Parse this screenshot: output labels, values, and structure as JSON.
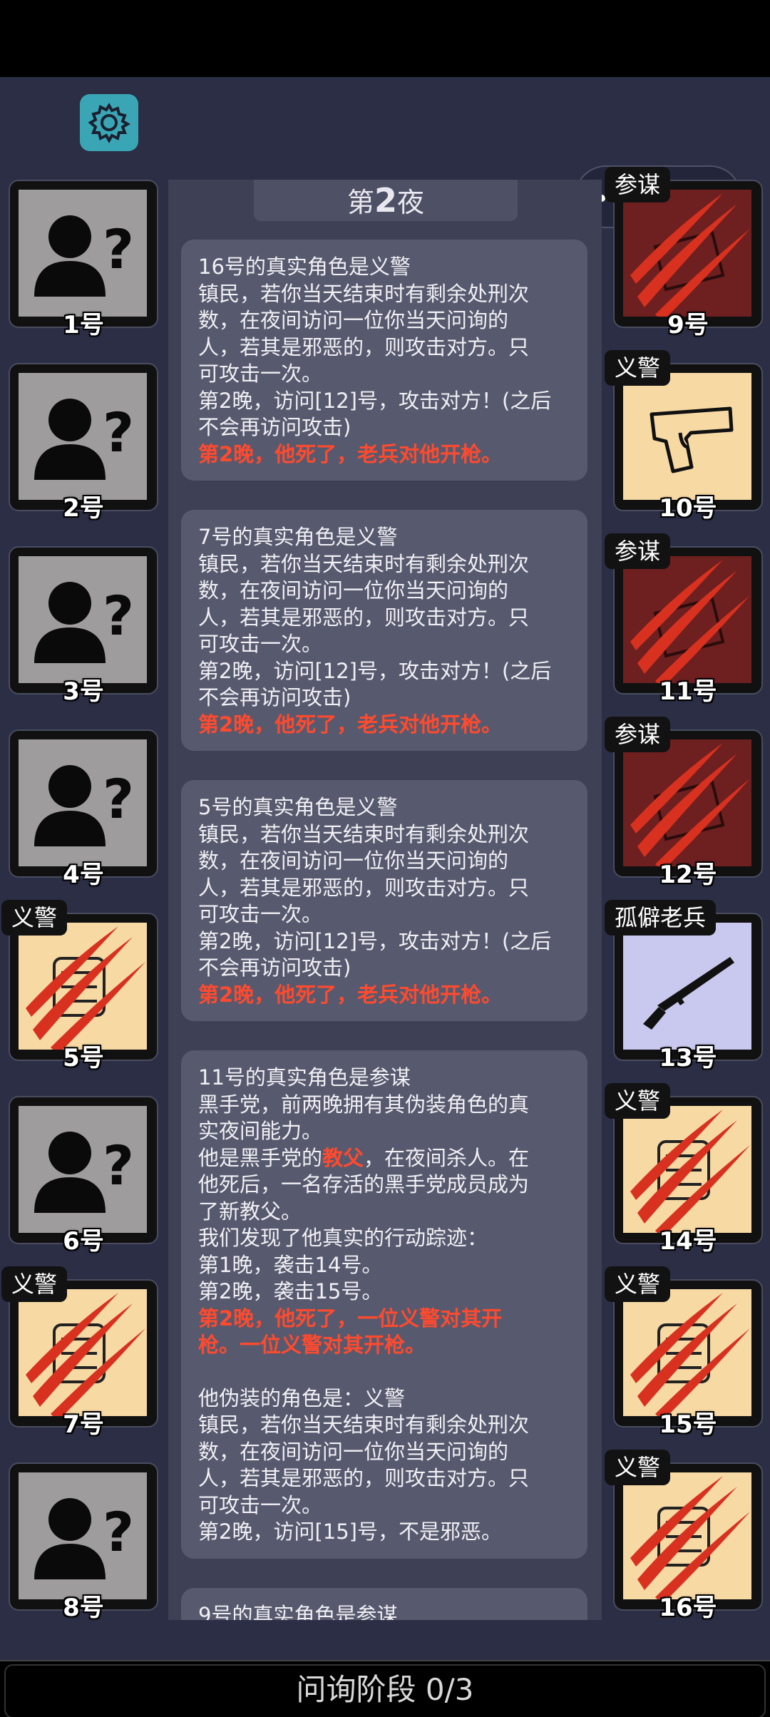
{
  "night_title_prefix": "第",
  "night_number": "2",
  "night_title_suffix": "夜",
  "left_seats": [
    {
      "num": "1号",
      "tag": "",
      "state": "unknown"
    },
    {
      "num": "2号",
      "tag": "",
      "state": "unknown"
    },
    {
      "num": "3号",
      "tag": "",
      "state": "unknown"
    },
    {
      "num": "4号",
      "tag": "",
      "state": "unknown"
    },
    {
      "num": "5号",
      "tag": "义警",
      "state": "dead-vigilante"
    },
    {
      "num": "6号",
      "tag": "",
      "state": "unknown"
    },
    {
      "num": "7号",
      "tag": "义警",
      "state": "dead-vigilante"
    },
    {
      "num": "8号",
      "tag": "",
      "state": "unknown"
    }
  ],
  "right_seats": [
    {
      "num": "9号",
      "tag": "参谋",
      "state": "dead-mafia"
    },
    {
      "num": "10号",
      "tag": "义警",
      "state": "vigilante-gun"
    },
    {
      "num": "11号",
      "tag": "参谋",
      "state": "dead-mafia"
    },
    {
      "num": "12号",
      "tag": "参谋",
      "state": "dead-mafia"
    },
    {
      "num": "13号",
      "tag": "孤僻老兵",
      "state": "veteran-rifle"
    },
    {
      "num": "14号",
      "tag": "义警",
      "state": "dead-vigilante"
    },
    {
      "num": "15号",
      "tag": "义警",
      "state": "dead-vigilante"
    },
    {
      "num": "16号",
      "tag": "义警",
      "state": "dead-vigilante"
    }
  ],
  "cards": [
    {
      "lines": [
        "16号的真实角色是义警",
        "镇民，若你当天结束时有剩余处刑次",
        "数，在夜间访问一位你当天问询的",
        "人，若其是邪恶的，则攻击对方。只",
        "可攻击一次。",
        "第2晚，访问[12]号，攻击对方！(之后",
        "不会再访问攻击)"
      ],
      "red": "第2晚，他死了，老兵对他开枪。"
    },
    {
      "lines": [
        "7号的真实角色是义警",
        "镇民，若你当天结束时有剩余处刑次",
        "数，在夜间访问一位你当天问询的",
        "人，若其是邪恶的，则攻击对方。只",
        "可攻击一次。",
        "第2晚，访问[12]号，攻击对方！(之后",
        "不会再访问攻击)"
      ],
      "red": "第2晚，他死了，老兵对他开枪。"
    },
    {
      "lines": [
        "5号的真实角色是义警",
        "镇民，若你当天结束时有剩余处刑次",
        "数，在夜间访问一位你当天问询的",
        "人，若其是邪恶的，则攻击对方。只",
        "可攻击一次。",
        "第2晚，访问[12]号，攻击对方！(之后",
        "不会再访问攻击)"
      ],
      "red": "第2晚，他死了，老兵对他开枪。"
    }
  ],
  "card4": {
    "title": "11号的真实角色是参谋",
    "l1": "黑手党，前两晚拥有其伪装角色的真",
    "l2": "实夜间能力。",
    "l3a": "他是黑手党的",
    "l3red": "教父",
    "l3b": "，在夜间杀人。在",
    "l4": "他死后，一名存活的黑手党成员成为",
    "l5": "了新教父。",
    "l6": "我们发现了他真实的行动踪迹：",
    "l7": "第1晚，袭击14号。",
    "l8": "第2晚，袭击15号。",
    "red1": "第2晚，他死了，一位义警对其开",
    "red2": "枪。一位义警对其开枪。",
    "l9": "他伪装的角色是：义警",
    "l10": "镇民，若你当天结束时有剩余处刑次",
    "l11": "数，在夜间访问一位你当天问询的",
    "l12": "人，若其是邪恶的，则攻击对方。只",
    "l13": "可攻击一次。",
    "l14": "第2晚，访问[15]号，不是邪恶。"
  },
  "card5_partial": "9号的真实角色是参谋",
  "bottom_label": "问询阶段 0/3",
  "colors": {
    "background": "#2b2e45",
    "panel": "#3e4156",
    "card": "#575a6e",
    "red_text": "#ff4a2e",
    "settings": "#3aa6b5"
  },
  "icons": {
    "settings": "gear-icon",
    "more": "more-dots-icon",
    "close": "target-icon"
  }
}
